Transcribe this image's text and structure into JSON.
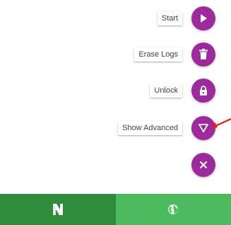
{
  "fab_menu": {
    "items": [
      {
        "label": "Start",
        "icon": "play-icon"
      },
      {
        "label": "Erase Logs",
        "icon": "trash-icon"
      },
      {
        "label": "Unlock",
        "icon": "lock-icon"
      },
      {
        "label": "Show Advanced",
        "icon": "triangle-down-icon"
      }
    ],
    "close_icon": "close-icon",
    "fab_color": "#9c2a9c"
  },
  "bottom_nav": {
    "tabs": [
      {
        "icon": "app-logo-icon",
        "active": true
      },
      {
        "icon": "globe-icon",
        "active": false
      }
    ],
    "active_color": "#2e8b3c",
    "inactive_color": "#4cbb5e"
  },
  "annotation": {
    "arrow_color": "#e02020"
  }
}
